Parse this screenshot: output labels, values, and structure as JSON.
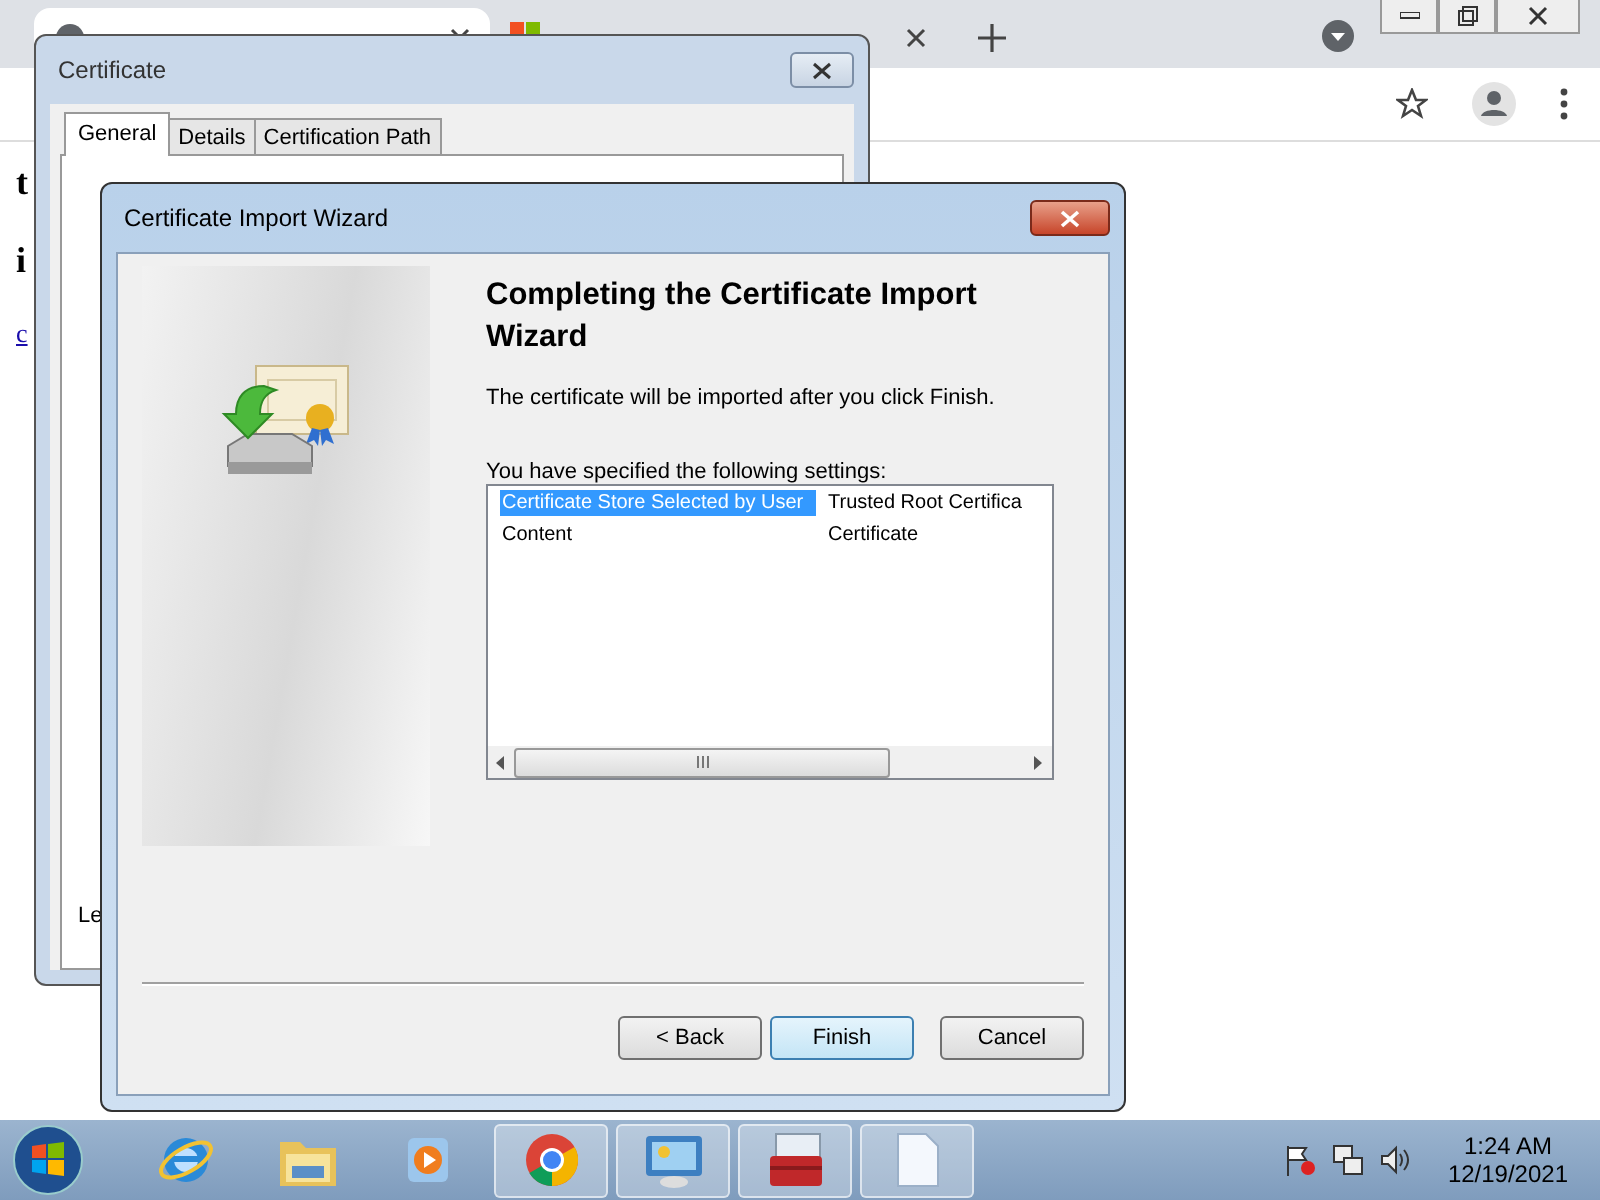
{
  "browser": {
    "tabs": [
      {
        "selected": true
      },
      {
        "selected": false
      }
    ],
    "page_fragments": [
      {
        "text": "t",
        "kind": "heading"
      },
      {
        "text": "i",
        "kind": "heading"
      },
      {
        "text": "c",
        "kind": "link"
      }
    ]
  },
  "certificate_dialog": {
    "title": "Certificate",
    "tabs": [
      {
        "label": "General",
        "selected": true
      },
      {
        "label": "Details",
        "selected": false
      },
      {
        "label": "Certification Path",
        "selected": false
      }
    ],
    "footer_fragment": "Le"
  },
  "wizard": {
    "title": "Certificate Import Wizard",
    "heading": "Completing the Certificate Import Wizard",
    "message": "The certificate will be imported after you click Finish.",
    "settings_label": "You have specified the following settings:",
    "settings": [
      {
        "name": "Certificate Store Selected by User",
        "value": "Trusted Root Certifica",
        "selected": true
      },
      {
        "name": "Content",
        "value": "Certificate",
        "selected": false
      }
    ],
    "buttons": [
      {
        "label": "< Back",
        "focused": false
      },
      {
        "label": "Finish",
        "focused": true
      },
      {
        "label": "Cancel",
        "focused": false
      }
    ]
  },
  "taskbar": {
    "apps": [
      {
        "kind": "ie",
        "open": false
      },
      {
        "kind": "folder",
        "open": false
      },
      {
        "kind": "media",
        "open": false
      },
      {
        "kind": "chrome",
        "open": true
      },
      {
        "kind": "panel",
        "open": true
      },
      {
        "kind": "toolbox",
        "open": true
      },
      {
        "kind": "document",
        "open": true
      }
    ],
    "time": "1:24 AM",
    "date": "12/19/2021"
  }
}
